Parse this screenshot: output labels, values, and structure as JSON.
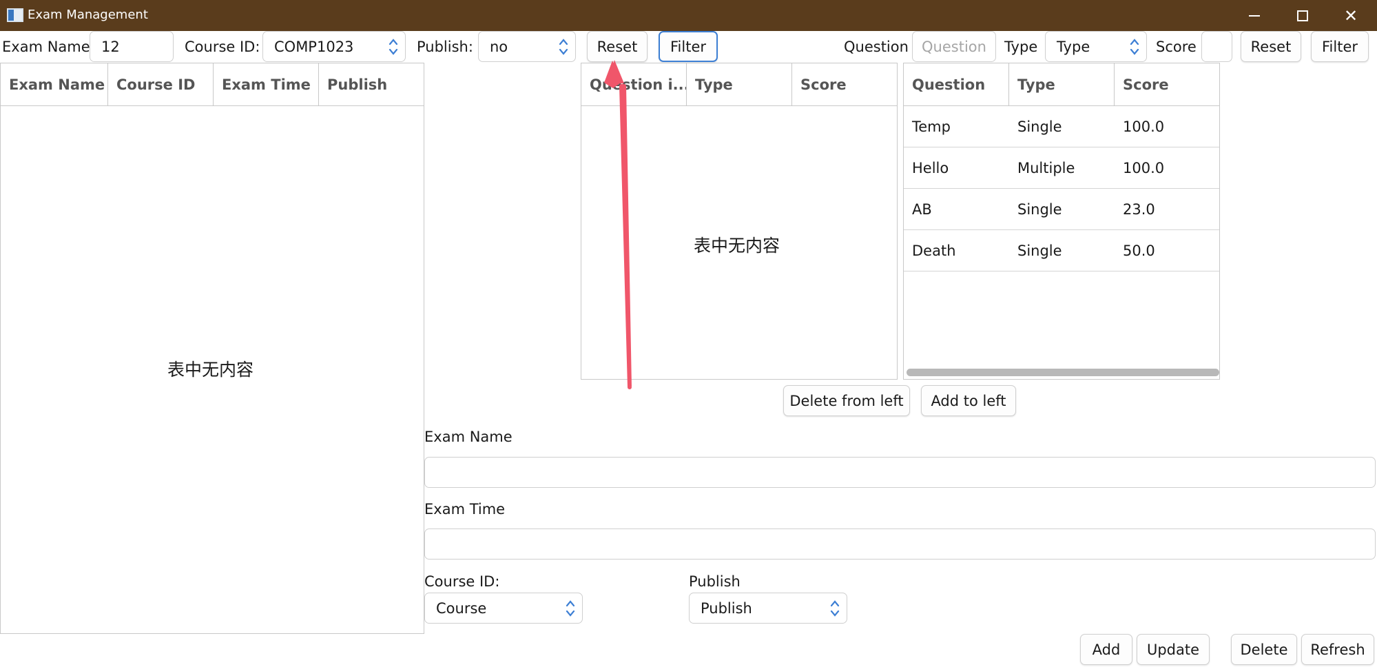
{
  "window": {
    "title": "Exam Management"
  },
  "top_filters": {
    "exam_name_label": "Exam Name",
    "exam_name_value": "12",
    "course_id_label": "Course ID:",
    "course_id_value": "COMP1023",
    "publish_label": "Publish:",
    "publish_value": "no",
    "reset_label": "Reset",
    "filter_label": "Filter"
  },
  "question_filters": {
    "question_label": "Question",
    "question_placeholder": "Question",
    "type_label": "Type",
    "type_value": "Type",
    "score_label": "Score",
    "score_value": "",
    "reset_label": "Reset",
    "filter_label": "Filter"
  },
  "exam_table": {
    "columns": [
      "Exam Name",
      "Course ID",
      "Exam Time",
      "Publish"
    ],
    "empty_text": "表中无内容"
  },
  "exam_question_table": {
    "columns": [
      "Question i...",
      "Type",
      "Score"
    ],
    "empty_text": "表中无内容"
  },
  "question_table": {
    "columns": [
      "Question",
      "Type",
      "Score"
    ],
    "rows": [
      {
        "question": "Temp",
        "type": "Single",
        "score": "100.0"
      },
      {
        "question": "Hello",
        "type": "Multiple",
        "score": "100.0"
      },
      {
        "question": "AB",
        "type": "Single",
        "score": "23.0"
      },
      {
        "question": "Death",
        "type": "Single",
        "score": "50.0"
      }
    ]
  },
  "transfer": {
    "delete_from_left_label": "Delete from left",
    "add_to_left_label": "Add to left"
  },
  "form": {
    "exam_name_label": "Exam Name",
    "exam_name_value": "",
    "exam_time_label": "Exam Time",
    "exam_time_value": "",
    "course_id_label": "Course ID:",
    "course_value": "Course",
    "publish_label": "Publish",
    "publish_value": "Publish"
  },
  "actions": {
    "add_label": "Add",
    "update_label": "Update",
    "delete_label": "Delete",
    "refresh_label": "Refresh"
  },
  "colors": {
    "titlebar": "#5a3c1c",
    "focus_border": "#3d7fd4",
    "annotation_arrow": "#f0566a"
  }
}
